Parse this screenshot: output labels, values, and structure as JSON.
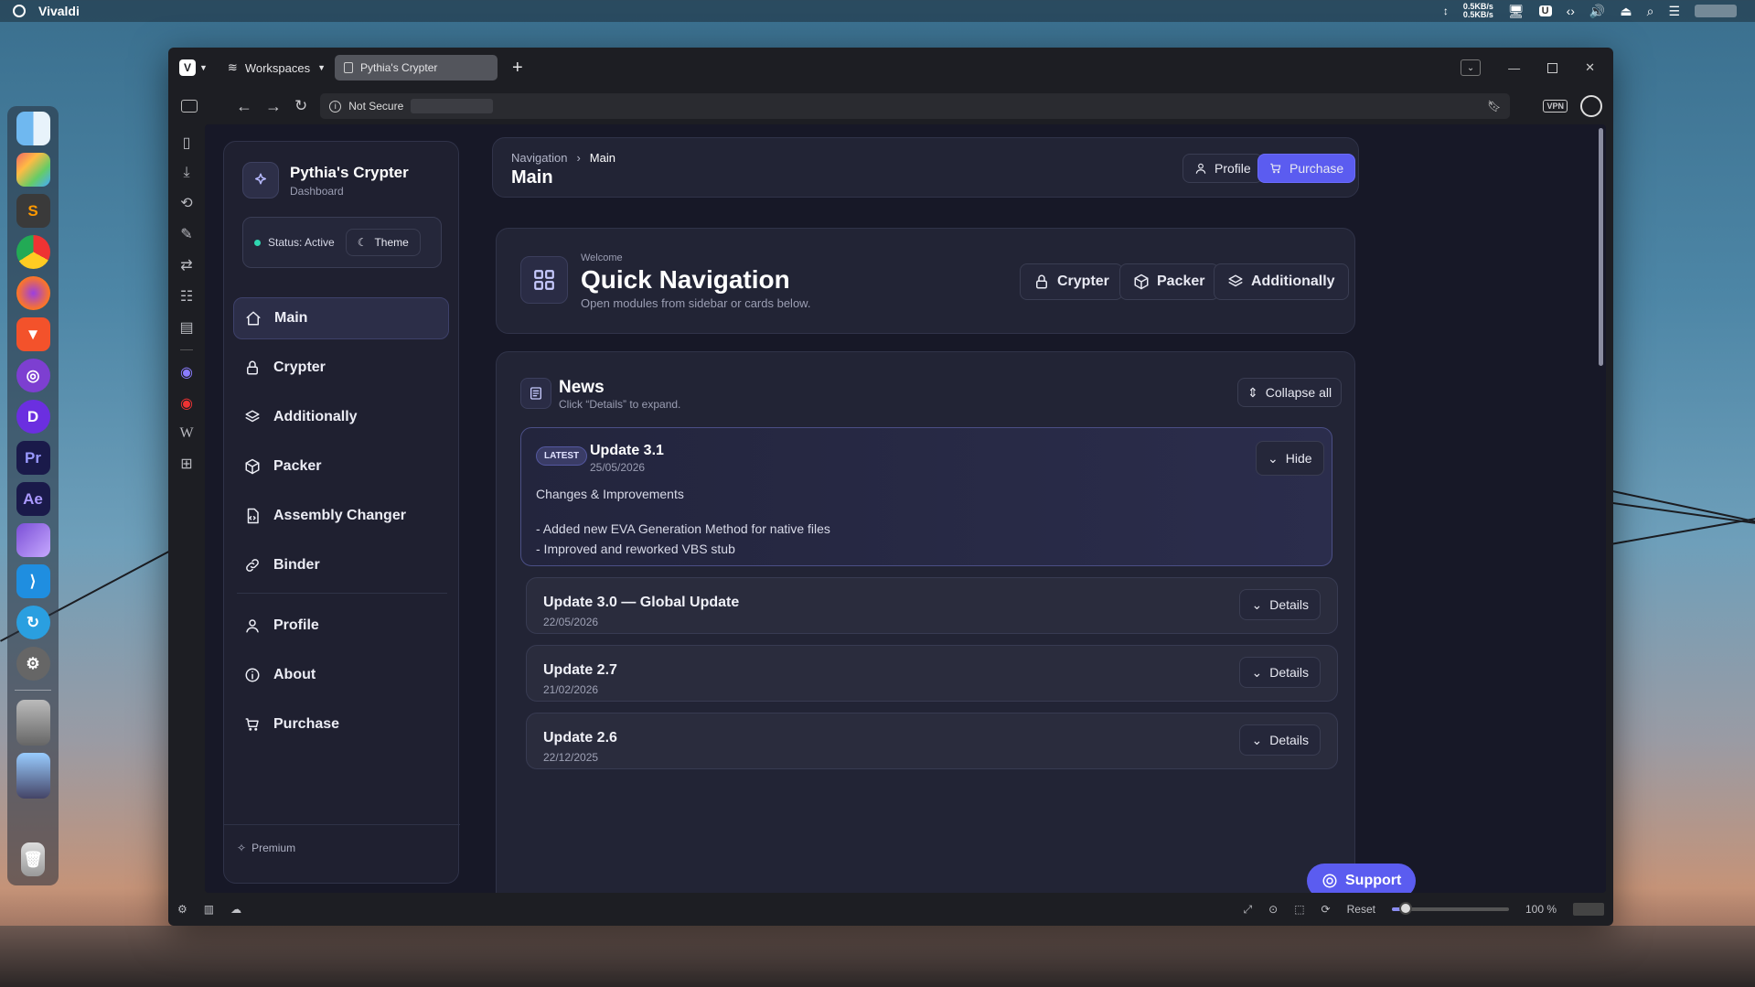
{
  "os": {
    "app_name": "Vivaldi",
    "net_up": "0.5KB/s",
    "net_down": "0.5KB/s"
  },
  "browser": {
    "workspaces_label": "Workspaces",
    "tab_title": "Pythia's Crypter",
    "security_label": "Not Secure",
    "vpn_label": "VPN",
    "reset_label": "Reset",
    "zoom": "100 %",
    "zoom_fraction": 0.12
  },
  "sidebar": {
    "app_title": "Pythia's Crypter",
    "app_subtitle": "Dashboard",
    "status_label": "Status: Active",
    "theme_label": "Theme",
    "nav_items": [
      {
        "label": "Main",
        "icon": "home-icon",
        "active": true
      },
      {
        "label": "Crypter",
        "icon": "lock-icon"
      },
      {
        "label": "Additionally",
        "icon": "layers-icon"
      },
      {
        "label": "Packer",
        "icon": "package-icon"
      },
      {
        "label": "Assembly Changer",
        "icon": "file-code-icon"
      },
      {
        "label": "Binder",
        "icon": "link-icon"
      }
    ],
    "nav_items_secondary": [
      {
        "label": "Profile",
        "icon": "user-icon"
      },
      {
        "label": "About",
        "icon": "info-icon"
      },
      {
        "label": "Purchase",
        "icon": "cart-icon"
      }
    ],
    "footer_label": "Premium"
  },
  "header": {
    "breadcrumb_root": "Navigation",
    "breadcrumb_current": "Main",
    "title": "Main",
    "profile_label": "Profile",
    "purchase_label": "Purchase"
  },
  "quicknav": {
    "kicker": "Welcome",
    "title": "Quick Navigation",
    "subtitle": "Open modules from sidebar or cards below.",
    "buttons": [
      "Crypter",
      "Packer",
      "Additionally"
    ]
  },
  "news": {
    "title": "News",
    "subtitle": "Click “Details” to expand.",
    "collapse_label": "Collapse all",
    "latest": {
      "badge": "LATEST",
      "title": "Update 3.1",
      "date": "25/05/2026",
      "hide_label": "Hide",
      "heading": "Changes & Improvements",
      "line1": "- Added new EVA Generation Method for native files",
      "line2": "- Improved and reworked VBS stub"
    },
    "items": [
      {
        "title": "Update 3.0 — Global Update",
        "date": "22/05/2026",
        "button": "Details"
      },
      {
        "title": "Update 2.7",
        "date": "21/02/2026",
        "button": "Details"
      },
      {
        "title": "Update 2.6",
        "date": "22/12/2025",
        "button": "Details"
      }
    ]
  },
  "support_label": "Support",
  "colors": {
    "accent": "#5b5cf0",
    "page_bg": "#171827",
    "panel_bg": "#222435",
    "status_dot": "#2fd6b0"
  }
}
